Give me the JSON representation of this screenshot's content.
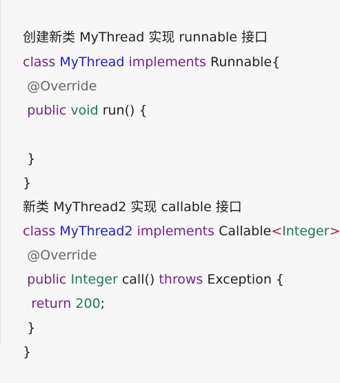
{
  "colors": {
    "background": "#f7f7f7",
    "text": "#1f1f1f",
    "class_name": "#1f1fd0",
    "keyword": "#7a1f8e",
    "type": "#1c7b53",
    "generic_bracket": "#b31c1c",
    "annotation": "#666666"
  },
  "lines": [
    {
      "segments": [
        {
          "text": "创建新类 MyThread 实现 runnable 接口",
          "tone": "black"
        }
      ]
    },
    {
      "segments": [
        {
          "text": "class",
          "tone": "purple"
        },
        {
          "text": " ",
          "tone": "black"
        },
        {
          "text": "MyThread",
          "tone": "blue"
        },
        {
          "text": " ",
          "tone": "black"
        },
        {
          "text": "implements",
          "tone": "purple"
        },
        {
          "text": " ",
          "tone": "black"
        },
        {
          "text": "Runnable",
          "tone": "black"
        },
        {
          "text": "{",
          "tone": "black"
        }
      ]
    },
    {
      "segments": [
        {
          "text": " @Override",
          "tone": "gray"
        }
      ]
    },
    {
      "segments": [
        {
          "text": " public",
          "tone": "purple"
        },
        {
          "text": " ",
          "tone": "black"
        },
        {
          "text": "void",
          "tone": "green"
        },
        {
          "text": " run() {",
          "tone": "black"
        }
      ]
    },
    {
      "segments": [
        {
          "text": "",
          "tone": "black"
        }
      ]
    },
    {
      "segments": [
        {
          "text": " }",
          "tone": "black"
        }
      ]
    },
    {
      "segments": [
        {
          "text": "}",
          "tone": "black"
        }
      ]
    },
    {
      "segments": [
        {
          "text": "新类 MyThread2 实现 callable 接口",
          "tone": "black"
        }
      ]
    },
    {
      "segments": [
        {
          "text": "class",
          "tone": "purple"
        },
        {
          "text": " ",
          "tone": "black"
        },
        {
          "text": "MyThread2",
          "tone": "blue"
        },
        {
          "text": " ",
          "tone": "black"
        },
        {
          "text": "implements",
          "tone": "purple"
        },
        {
          "text": " ",
          "tone": "black"
        },
        {
          "text": "Callable",
          "tone": "black"
        },
        {
          "text": "<",
          "tone": "red"
        },
        {
          "text": "Integer",
          "tone": "green"
        },
        {
          "text": ">",
          "tone": "red"
        },
        {
          "text": "{",
          "tone": "black"
        }
      ]
    },
    {
      "segments": [
        {
          "text": " @Override",
          "tone": "gray"
        }
      ]
    },
    {
      "segments": [
        {
          "text": " public",
          "tone": "purple"
        },
        {
          "text": " ",
          "tone": "black"
        },
        {
          "text": "Integer",
          "tone": "green"
        },
        {
          "text": " call() ",
          "tone": "black"
        },
        {
          "text": "throws",
          "tone": "purple"
        },
        {
          "text": " Exception {",
          "tone": "black"
        }
      ]
    },
    {
      "segments": [
        {
          "text": "  return",
          "tone": "purple"
        },
        {
          "text": " ",
          "tone": "black"
        },
        {
          "text": "200",
          "tone": "green"
        },
        {
          "text": ";",
          "tone": "black"
        }
      ]
    },
    {
      "segments": [
        {
          "text": " }",
          "tone": "black"
        }
      ]
    },
    {
      "segments": [
        {
          "text": "}",
          "tone": "black"
        }
      ]
    }
  ]
}
